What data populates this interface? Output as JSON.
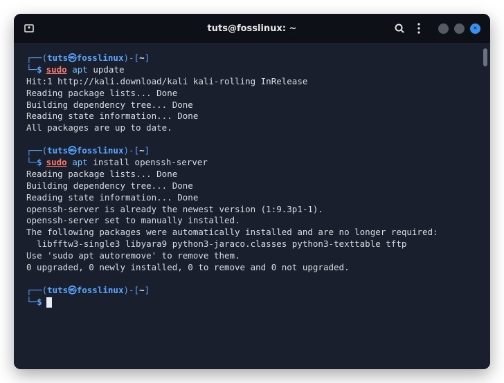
{
  "titlebar": {
    "title": "tuts@fosslinux: ~"
  },
  "prompts": {
    "user": "tuts",
    "symbol": "㉿",
    "host": "fosslinux",
    "path": "~",
    "dollar": "$"
  },
  "commands": {
    "sudo": "sudo",
    "apt": "apt",
    "update": "update",
    "install_args": "install openssh-server"
  },
  "output": {
    "l1": "Hit:1 http://kali.download/kali kali-rolling InRelease",
    "l2": "Reading package lists... Done",
    "l3": "Building dependency tree... Done",
    "l4": "Reading state information... Done",
    "l5": "All packages are up to date.",
    "l6": "Reading package lists... Done",
    "l7": "Building dependency tree... Done",
    "l8": "Reading state information... Done",
    "l9": "openssh-server is already the newest version (1:9.3p1-1).",
    "l10": "openssh-server set to manually installed.",
    "l11": "The following packages were automatically installed and are no longer required:",
    "l12": "  libfftw3-single3 libyara9 python3-jaraco.classes python3-texttable tftp",
    "l13": "Use 'sudo apt autoremove' to remove them.",
    "l14": "0 upgraded, 0 newly installed, 0 to remove and 0 not upgraded."
  }
}
